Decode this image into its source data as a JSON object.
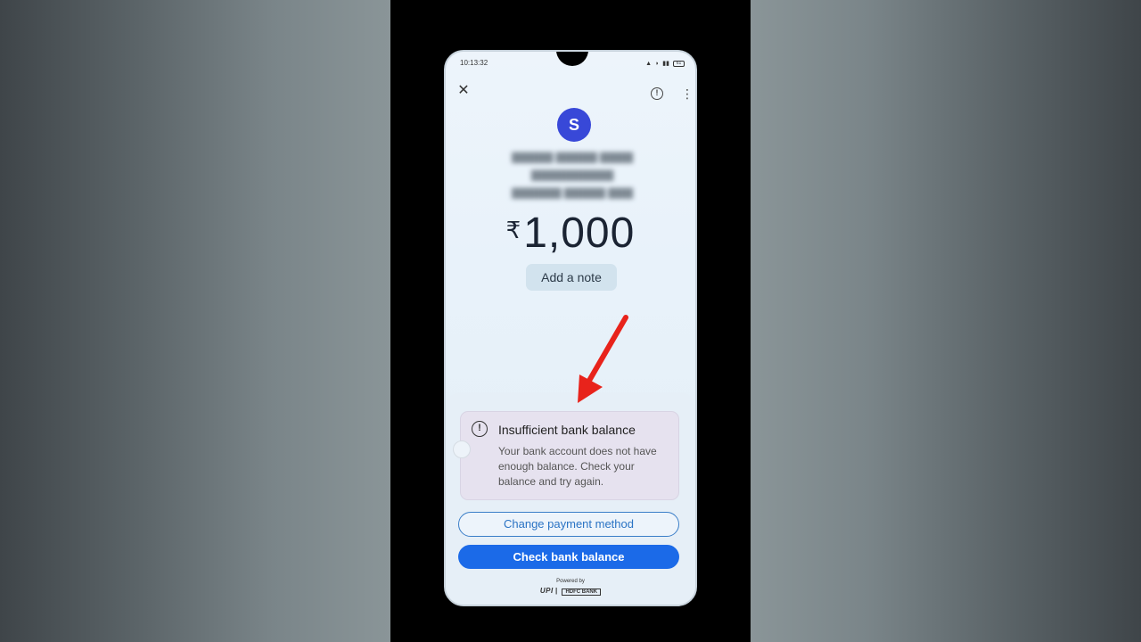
{
  "status_bar": {
    "time": "10:13:32",
    "battery": "61"
  },
  "header": {
    "close_icon": "close-icon",
    "info_icon": "info-icon",
    "more_icon": "more-vertical-icon"
  },
  "payee": {
    "avatar_initial": "S"
  },
  "payment": {
    "currency_symbol": "₹",
    "amount": "1,000",
    "note_button_label": "Add a note"
  },
  "alert": {
    "icon": "warning-circle-icon",
    "title": "Insufficient bank balance",
    "message": "Your bank account does not have enough balance. Check your balance and try again."
  },
  "actions": {
    "change_payment_label": "Change payment method",
    "check_balance_label": "Check bank balance"
  },
  "footer": {
    "powered_by": "Powered by",
    "upi_logo": "UPI",
    "bank_logo": "HDFC BANK"
  },
  "annotation": {
    "arrow_color": "#e8231b"
  },
  "colors": {
    "primary_button": "#1b6ae8",
    "avatar": "#3848d8",
    "alert_bg": "#e6e2ef"
  }
}
